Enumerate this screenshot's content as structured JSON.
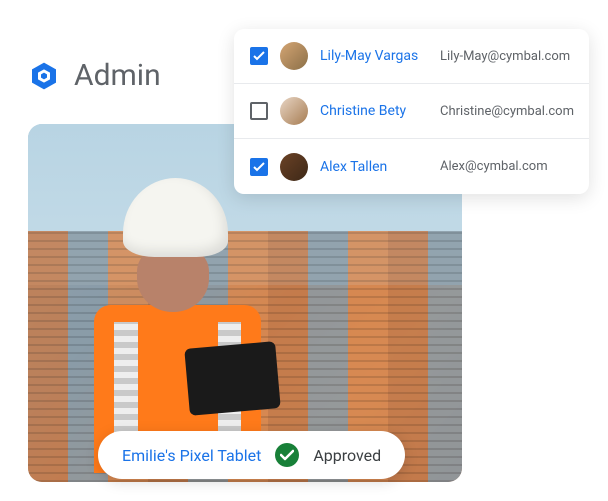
{
  "header": {
    "admin_label": "Admin"
  },
  "users": [
    {
      "name": "Lily-May Vargas",
      "email": "Lily-May@cymbal.com",
      "checked": true,
      "avatar_bg": "linear-gradient(135deg,#d4a574,#8b6f47)"
    },
    {
      "name": "Christine Bety",
      "email": "Christine@cymbal.com",
      "checked": false,
      "avatar_bg": "linear-gradient(135deg,#e8d5c4,#a67c52)"
    },
    {
      "name": "Alex Tallen",
      "email": "Alex@cymbal.com",
      "checked": true,
      "avatar_bg": "linear-gradient(135deg,#6b4226,#3d2817)"
    }
  ],
  "device": {
    "name": "Emilie's Pixel Tablet",
    "status_label": "Approved"
  }
}
